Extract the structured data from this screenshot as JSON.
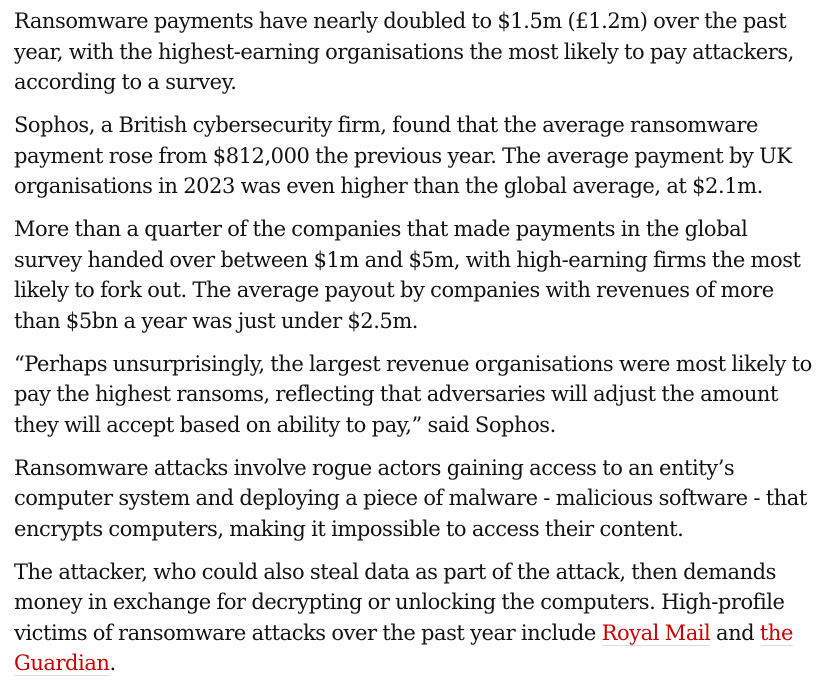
{
  "article": {
    "paragraphs": [
      "Ransomware payments have nearly doubled to $1.5m (£1.2m) over the past year, with the highest-earning organisations the most likely to pay attackers, according to a survey.",
      "Sophos, a British cybersecurity firm, found that the average ransomware payment rose from $812,000 the previous year. The average payment by UK organisations in 2023 was even higher than the global average, at $2.1m.",
      "More than a quarter of the companies that made payments in the global survey handed over between $1m and $5m, with high-earning firms the most likely to fork out. The average payout by companies with revenues of more than $5bn a year was just under $2.5m.",
      "“Perhaps unsurprisingly, the largest revenue organisations were most likely to pay the highest ransoms, reflecting that adversaries will adjust the amount they will accept based on ability to pay,” said Sophos.",
      "Ransomware attacks involve rogue actors gaining access to an entity’s computer system and deploying a piece of malware - malicious software - that encrypts computers, making it impossible to access their content."
    ],
    "last_paragraph": {
      "text_before": "The attacker, who could also steal data as part of the attack, then demands money in exchange for decrypting or unlocking the computers. High-profile victims of ransomware attacks over the past year include ",
      "link_royal_mail": "Royal Mail",
      "text_between": " and ",
      "link_guardian": "the Guardian",
      "text_after": "."
    }
  },
  "colors": {
    "text": "#121212",
    "link": "#c70000",
    "background": "#ffffff"
  }
}
